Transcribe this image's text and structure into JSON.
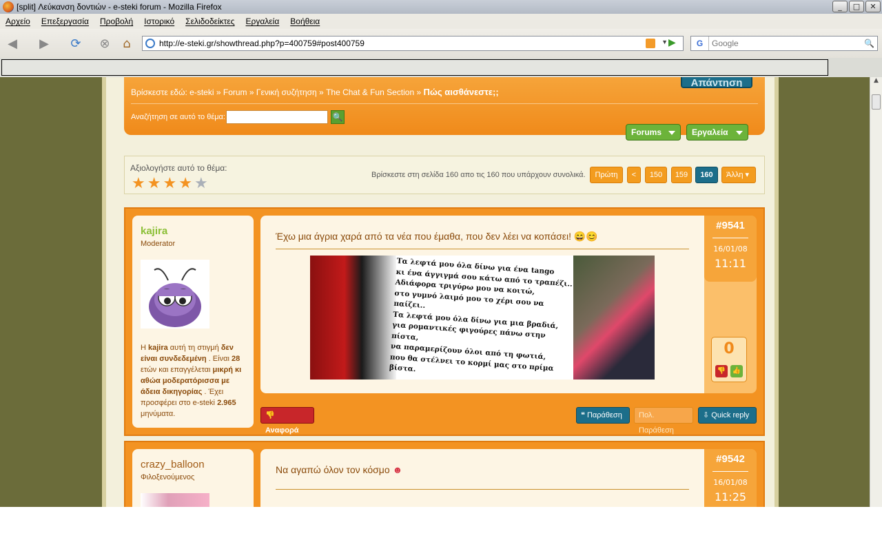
{
  "window": {
    "title": "[split] Λεύκανση δοντιών - e-steki forum - Mozilla Firefox"
  },
  "menu": [
    "Αρχείο",
    "Επεξεργασία",
    "Προβολή",
    "Ιστορικό",
    "Σελιδοδείκτες",
    "Εργαλεία",
    "Βοήθεια"
  ],
  "address": {
    "url": "http://e-steki.gr/showthread.php?p=400759#post400759"
  },
  "search": {
    "placeholder": "Google",
    "engine": "G"
  },
  "breadcrumb": {
    "prefix": "Βρίσκεστε εδώ:",
    "items": [
      "e-steki",
      "Forum",
      "Γενική συζήτηση",
      "The Chat & Fun Section"
    ],
    "current": "Πώς αισθάνεστε;;"
  },
  "reply_button": "Απάντηση",
  "thread_search": {
    "label": "Αναζήτηση σε αυτό το θέμα:",
    "value": ""
  },
  "menus": {
    "forums": "Forums",
    "tools": "Εργαλεία"
  },
  "rating": {
    "label": "Αξιολογήστε αυτό το θέμα:",
    "stars": 4,
    "max": 5
  },
  "pagination": {
    "info": "Βρίσκεστε στη σελίδα 160 απο τις 160 που υπάρχουν συνολικά.",
    "first": "Πρώτη",
    "prev": "<",
    "pages": [
      "150",
      "159",
      "160"
    ],
    "current": "160",
    "other": "Άλλη"
  },
  "posts": [
    {
      "user": "kajira",
      "role": "Moderator",
      "bio_parts": [
        "Η ",
        "kajira",
        " αυτή τη στιγμή ",
        "δεν είναι συνδεδεμένη",
        " . Είναι ",
        "28",
        " ετών και επαγγέλεται ",
        "μικρή κι αθώα μοδερατόρισσα με άδεια δικηγορίας",
        " . Έχει προσφέρει στο e-steki ",
        "2.965",
        " μηνύματα."
      ],
      "title": "Έχω μια άγρια χαρά από τα νέα που έμαθα, που δεν λέει να κοπάσει!",
      "number": "#9541",
      "date": "16/01/08",
      "time": "11:11",
      "score": "0",
      "image_lines": [
        "Τα λεφτά μου όλα δίνω για ένα tango",
        "κι ένα άγγιγμά σου κάτω από το τραπέζι..",
        "Αδιάφορα τριγύρω μου να κοιτώ,",
        "στο γυμνό λαιμό μου το χέρι σου να παίζει..",
        "Τα λεφτά μου όλα δίνω για μια βραδιά,",
        "για ρομαντικές φιγούρες πάνω στην πίστα,",
        "να παραμερίζουν όλοι από τη φωτιά,",
        "που θα στέλνει το κορμί μας στο πρίμα βίστα."
      ],
      "actions": {
        "report": "Αναφορά",
        "quote": "Παράθεση",
        "multi_quote": "Πολ. Παράθεση",
        "quick_reply": "Quick reply"
      }
    },
    {
      "user": "crazy_balloon",
      "role": "Φιλοξενούμενος",
      "title": "Να αγαπώ όλον τον κόσμο",
      "number": "#9542",
      "date": "16/01/08",
      "time": "11:25"
    }
  ],
  "colors": {
    "accent": "#f39322",
    "green": "#6cb33a",
    "teal": "#1c6e8a",
    "background": "#6b6c3a"
  }
}
